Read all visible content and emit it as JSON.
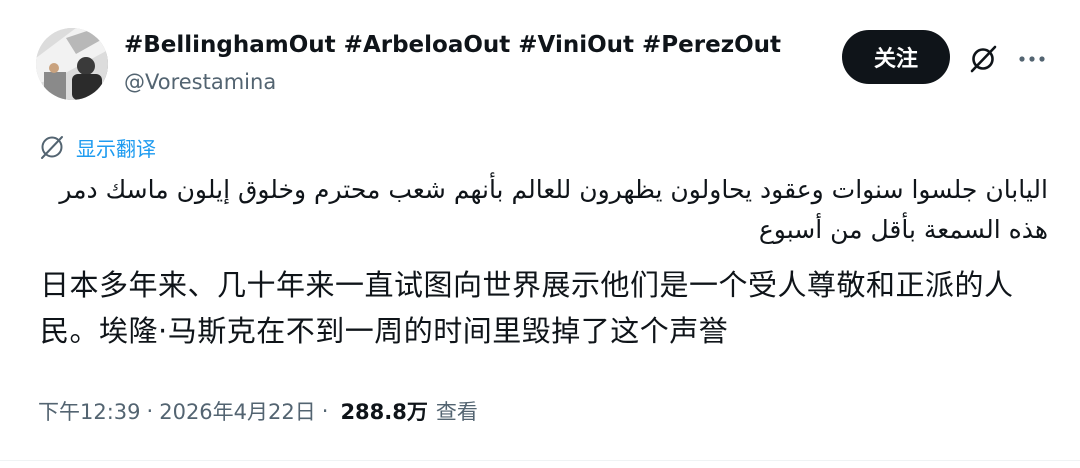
{
  "author": {
    "display_name": "#BellinghamOut #ArbeloaOut #ViniOut #PerezOut",
    "handle": "@Vorestamina"
  },
  "actions": {
    "follow_label": "关注",
    "grok_icon": "grok-icon",
    "more_icon": "more-horizontal-icon"
  },
  "translate": {
    "label": "显示翻译",
    "icon": "globe-icon"
  },
  "content": {
    "arabic": "اليابان جلسوا سنوات وعقود يحاولون يظهرون للعالم بأنهم شعب محترم وخلوق إيلون ماسك دمر هذه السمعة بأقل من أسبوع",
    "chinese": "日本多年来、几十年来一直试图向世界展示他们是一个受人尊敬和正派的人民。埃隆·马斯克在不到一周的时间里毁掉了这个声誉"
  },
  "meta": {
    "time": "下午12:39",
    "separator": "·",
    "date": "2026年4月22日",
    "views_count": "288.8万",
    "views_label": "查看"
  },
  "colors": {
    "link": "#1d9bf0",
    "secondary_text": "#536471",
    "button_bg": "#0f1419"
  }
}
